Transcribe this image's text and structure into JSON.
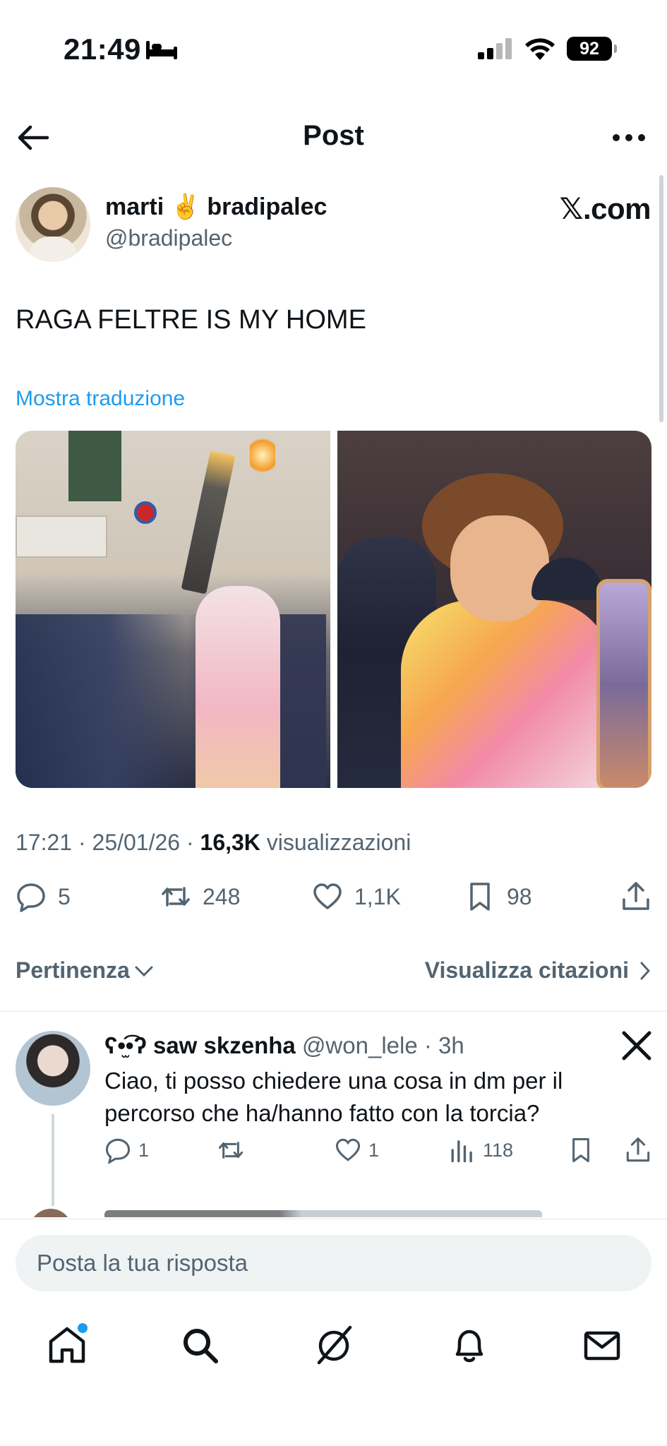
{
  "status_bar": {
    "time": "21:49",
    "battery": "92"
  },
  "header": {
    "title": "Post"
  },
  "post": {
    "author_name": "marti ✌️ bradipalec",
    "author_handle": "@bradipalec",
    "source_watermark": "𝕏.com",
    "text": "RAGA FELTRE IS MY HOME",
    "translate_label": "Mostra traduzione",
    "timestamp": "17:21 · 25/01/26 · ",
    "views_count": "16,3K",
    "views_label": " visualizzazioni",
    "replies": "5",
    "reposts": "248",
    "likes": "1,1K",
    "bookmarks": "98"
  },
  "filters": {
    "sort_label": "Pertinenza",
    "quotes_label": "Visualizza citazioni"
  },
  "reply": {
    "name": "ʕ•̫͡•ʔ saw skzenha",
    "handle": "@won_lele",
    "time": " · 3h",
    "text": "Ciao, ti posso chiedere una cosa in dm per il percorso che ha/hanno fatto con la torcia?",
    "replies": "1",
    "likes": "1",
    "views": "118"
  },
  "compose": {
    "placeholder": "Posta la tua risposta"
  },
  "colors": {
    "accent": "#1d9bf0",
    "secondary_text": "#536471"
  }
}
